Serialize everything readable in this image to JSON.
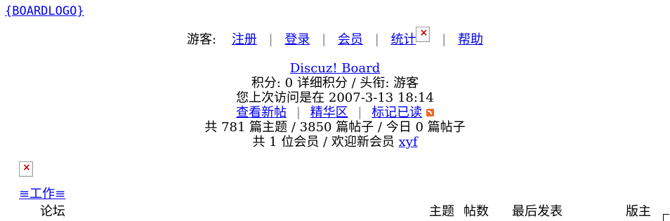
{
  "logo": {
    "text": "{BOARDLOGO}"
  },
  "topnav": {
    "guest_label": "游客:",
    "register": "注册",
    "login": "登录",
    "members": "会员",
    "stats": "统计",
    "help": "帮助",
    "separator": "|"
  },
  "info": {
    "board_name": "Discuz! Board",
    "credits_line": "积分: 0 详细积分 / 头衔: 游客",
    "last_visit": "您上次访问是在 2007-3-13 18:14",
    "new_posts": "查看新帖",
    "digest": "精华区",
    "mark_read": "标记已读",
    "separator": "|",
    "stats_line": "共 781 篇主题 / 3850 篇帖子 / 今日 0 篇帖子",
    "members_prefix": "共 1 位会员 / 欢迎新会员",
    "newest_member": "xyf"
  },
  "category": {
    "title": "≡工作≡"
  },
  "table_header": {
    "forum": "论坛",
    "topics": "主题",
    "posts": "帖数",
    "last_post": "最后发表",
    "moderator": "版主"
  },
  "icons": {
    "broken_image": "broken-image-icon",
    "rss": "rss-icon"
  },
  "colors": {
    "link": "#0000ee",
    "separator": "#888888",
    "rss": "#f26522"
  }
}
